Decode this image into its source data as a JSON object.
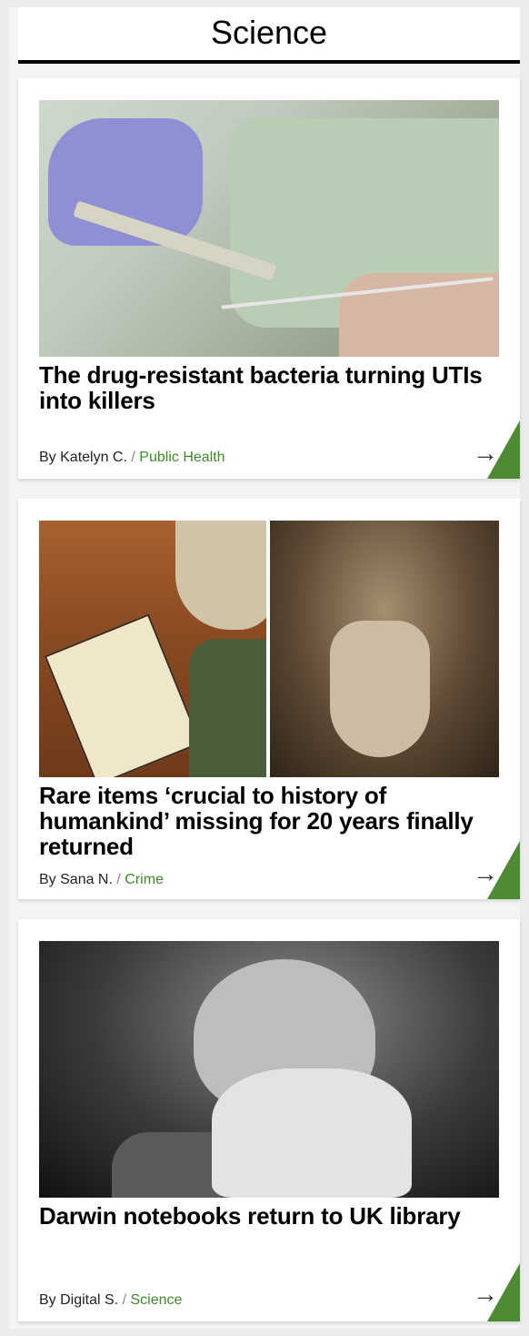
{
  "section": {
    "title": "Science"
  },
  "articles": [
    {
      "title": "The drug-resistant bacteria turning UTIs into killers",
      "author": "By Katelyn C.",
      "separator": "/",
      "category": "Public Health",
      "arrow": "→"
    },
    {
      "title": "Rare items ‘crucial to history of humankind’ missing for 20 years finally returned",
      "author": "By Sana N.",
      "separator": "/",
      "category": "Crime",
      "arrow": "→"
    },
    {
      "title": "Darwin notebooks return to UK library",
      "author": "By Digital S.",
      "separator": "/",
      "category": "Science",
      "arrow": "→"
    }
  ],
  "colors": {
    "accent": "#4c8a33",
    "category_text": "#3f8a2b"
  }
}
